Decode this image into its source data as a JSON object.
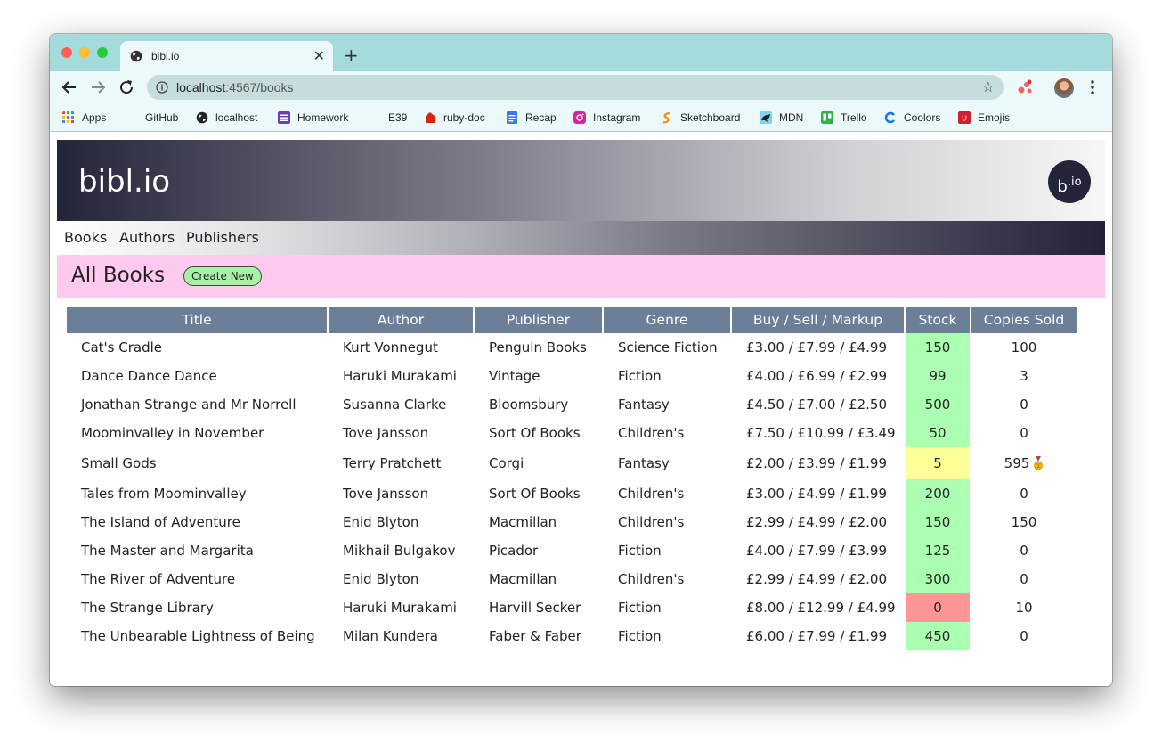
{
  "browser": {
    "tab_title": "bibl.io",
    "url_host": "localhost",
    "url_path": ":4567/books",
    "bookmarks": [
      "Apps",
      "GitHub",
      "localhost",
      "Homework",
      "E39",
      "ruby-doc",
      "Recap",
      "Instagram",
      "Sketchboard",
      "MDN",
      "Trello",
      "Coolors",
      "Emojis"
    ]
  },
  "site": {
    "title": "bibl.io",
    "logo_main": "b",
    "logo_sup": ".io",
    "nav": [
      "Books",
      "Authors",
      "Publishers"
    ]
  },
  "page": {
    "heading": "All Books",
    "create_label": "Create New"
  },
  "table": {
    "headers": [
      "Title",
      "Author",
      "Publisher",
      "Genre",
      "Buy / Sell / Markup",
      "Stock",
      "Copies Sold"
    ],
    "rows": [
      {
        "title": "Cat's Cradle",
        "author": "Kurt Vonnegut",
        "publisher": "Penguin Books",
        "genre": "Science Fiction",
        "prices": "£3.00 / £7.99 / £4.99",
        "stock": "150",
        "stock_status": "ok",
        "sold": "100"
      },
      {
        "title": "Dance Dance Dance",
        "author": "Haruki Murakami",
        "publisher": "Vintage",
        "genre": "Fiction",
        "prices": "£4.00 / £6.99 / £2.99",
        "stock": "99",
        "stock_status": "ok",
        "sold": "3"
      },
      {
        "title": "Jonathan Strange and Mr Norrell",
        "author": "Susanna Clarke",
        "publisher": "Bloomsbury",
        "genre": "Fantasy",
        "prices": "£4.50 / £7.00 / £2.50",
        "stock": "500",
        "stock_status": "ok",
        "sold": "0"
      },
      {
        "title": "Moominvalley in November",
        "author": "Tove Jansson",
        "publisher": "Sort Of Books",
        "genre": "Children's",
        "prices": "£7.50 / £10.99 / £3.49",
        "stock": "50",
        "stock_status": "ok",
        "sold": "0"
      },
      {
        "title": "Small Gods",
        "author": "Terry Pratchett",
        "publisher": "Corgi",
        "genre": "Fantasy",
        "prices": "£2.00 / £3.99 / £1.99",
        "stock": "5",
        "stock_status": "low",
        "sold": "595",
        "medal": true
      },
      {
        "title": "Tales from Moominvalley",
        "author": "Tove Jansson",
        "publisher": "Sort Of Books",
        "genre": "Children's",
        "prices": "£3.00 / £4.99 / £1.99",
        "stock": "200",
        "stock_status": "ok",
        "sold": "0"
      },
      {
        "title": "The Island of Adventure",
        "author": "Enid Blyton",
        "publisher": "Macmillan",
        "genre": "Children's",
        "prices": "£2.99 / £4.99 / £2.00",
        "stock": "150",
        "stock_status": "ok",
        "sold": "150"
      },
      {
        "title": "The Master and Margarita",
        "author": "Mikhail Bulgakov",
        "publisher": "Picador",
        "genre": "Fiction",
        "prices": "£4.00 / £7.99 / £3.99",
        "stock": "125",
        "stock_status": "ok",
        "sold": "0"
      },
      {
        "title": "The River of Adventure",
        "author": "Enid Blyton",
        "publisher": "Macmillan",
        "genre": "Children's",
        "prices": "£2.99 / £4.99 / £2.00",
        "stock": "300",
        "stock_status": "ok",
        "sold": "0"
      },
      {
        "title": "The Strange Library",
        "author": "Haruki Murakami",
        "publisher": "Harvill Secker",
        "genre": "Fiction",
        "prices": "£8.00 / £12.99 / £4.99",
        "stock": "0",
        "stock_status": "out",
        "sold": "10"
      },
      {
        "title": "The Unbearable Lightness of Being",
        "author": "Milan Kundera",
        "publisher": "Faber & Faber",
        "genre": "Fiction",
        "prices": "£6.00 / £7.99 / £1.99",
        "stock": "450",
        "stock_status": "ok",
        "sold": "0"
      }
    ]
  }
}
